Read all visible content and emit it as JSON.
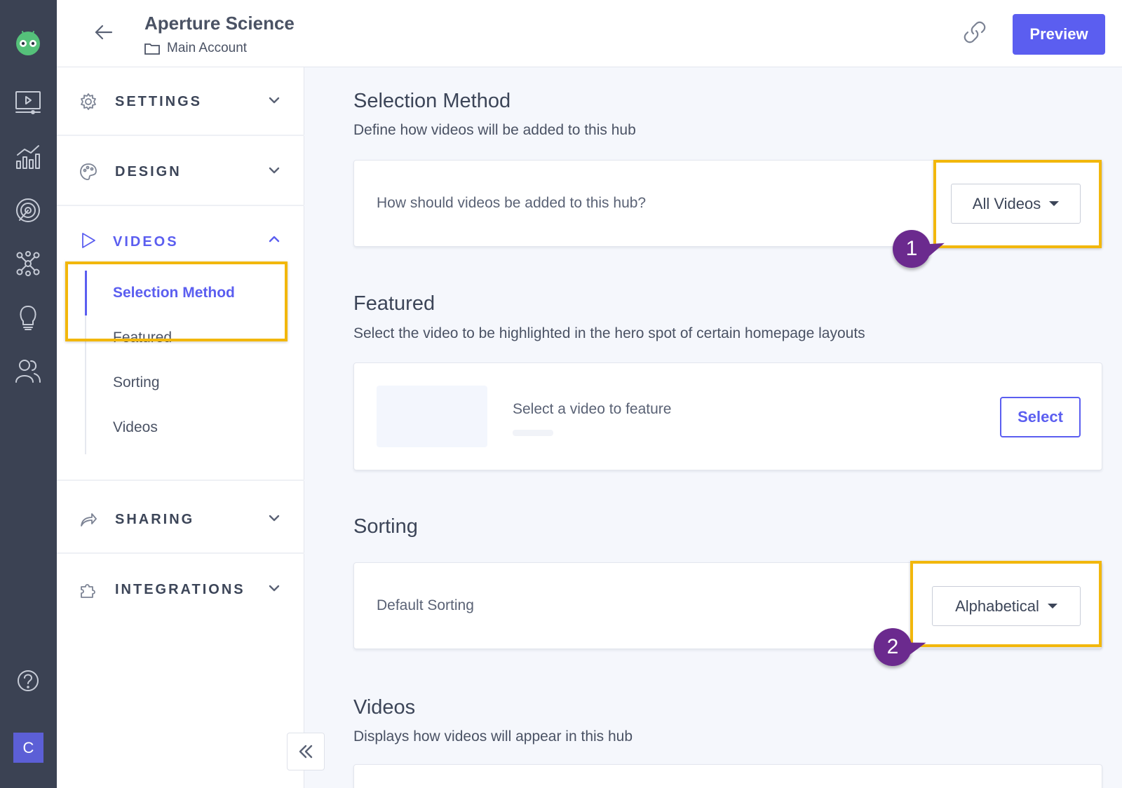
{
  "header": {
    "title": "Aperture Science",
    "account": "Main Account",
    "preview_label": "Preview"
  },
  "rail": {
    "avatar_letter": "C",
    "icons": [
      "robot-logo-icon",
      "video-player-icon",
      "analytics-icon",
      "target-icon",
      "network-icon",
      "lightbulb-icon",
      "users-icon",
      "help-icon"
    ]
  },
  "sidebar": {
    "sections": [
      {
        "label": "SETTINGS",
        "icon": "gear-icon"
      },
      {
        "label": "DESIGN",
        "icon": "palette-icon"
      },
      {
        "label": "VIDEOS",
        "icon": "play-icon"
      },
      {
        "label": "SHARING",
        "icon": "share-icon"
      },
      {
        "label": "INTEGRATIONS",
        "icon": "puzzle-icon"
      }
    ],
    "video_items": [
      "Selection Method",
      "Featured",
      "Sorting",
      "Videos"
    ]
  },
  "main": {
    "selection": {
      "heading": "Selection Method",
      "description": "Define how videos will be added to this hub",
      "question": "How should videos be added to this hub?",
      "dropdown_value": "All Videos"
    },
    "featured": {
      "heading": "Featured",
      "description": "Select the video to be highlighted in the hero spot of certain homepage layouts",
      "placeholder": "Select a video to feature",
      "button_label": "Select"
    },
    "sorting": {
      "heading": "Sorting",
      "label": "Default Sorting",
      "dropdown_value": "Alphabetical"
    },
    "videos": {
      "heading": "Videos",
      "description": "Displays how videos will appear in this hub"
    }
  },
  "annotations": {
    "callout_1": "1",
    "callout_2": "2",
    "highlight_color": "#f2b70c",
    "callout_color": "#6b2a8e"
  },
  "colors": {
    "accent": "#5b5ef0",
    "rail": "#3b4253"
  }
}
